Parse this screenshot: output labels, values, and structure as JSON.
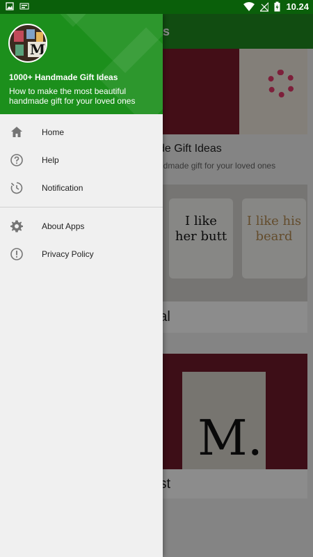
{
  "status_bar": {
    "time": "10.24",
    "battery_level": "charging"
  },
  "background_app": {
    "title_visible": "eas",
    "card_title_visible": "de Gift Ideas",
    "card_subtitle_visible": "ndmade gift for your loved ones",
    "mug1_text": "I like her butt",
    "mug2_text": "I like his beard",
    "card1_label": "Viral",
    "card2_label": "Best",
    "hero_letter": "M.",
    "card2_letter": "M."
  },
  "drawer": {
    "title": "1000+ Handmade Gift Ideas",
    "subtitle": "How to make the most beautiful handmade gift for your loved ones",
    "avatar_letter": "M",
    "header_color": "#1c8f1c",
    "items_primary": [
      {
        "label": "Home",
        "icon": "home-icon"
      },
      {
        "label": "Help",
        "icon": "help-icon"
      },
      {
        "label": "Notification",
        "icon": "notification-icon"
      }
    ],
    "items_secondary": [
      {
        "label": "About Apps",
        "icon": "gear-icon"
      },
      {
        "label": "Privacy Policy",
        "icon": "alert-icon"
      }
    ]
  }
}
